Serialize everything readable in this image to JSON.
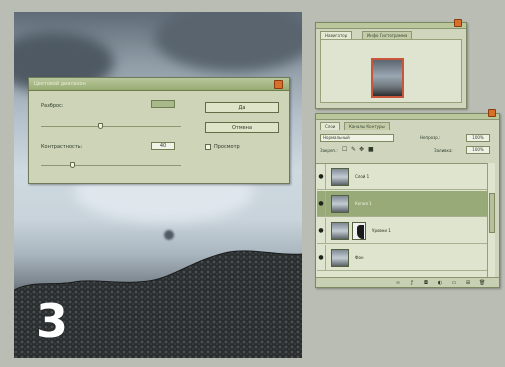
{
  "step_number": "3",
  "dialog": {
    "title": "Цветовой диапазон",
    "fuzziness_label": "Разброс:",
    "fuzziness_value": "",
    "fuzziness_level": 0.42,
    "second_label": "Контрастность:",
    "second_value": "40",
    "second_level": 0.22,
    "ok_label": "Да",
    "cancel_label": "Отмена",
    "preview_label": "Просмотр",
    "preview_checked": false
  },
  "navigator": {
    "tab_1": "Навигатор",
    "tab_2": "Инфо Гистограмма",
    "zoom": ""
  },
  "layers": {
    "tab_1": "Слои",
    "tab_2": "Каналы Контуры",
    "blend_mode": "Нормальный",
    "opacity_label": "Непрозр.:",
    "opacity_value": "100%",
    "lock_label": "Закреп.:",
    "fill_label": "Заливка:",
    "fill_value": "100%",
    "items": [
      {
        "name": "Слой 1",
        "selected": false,
        "has_mask": false
      },
      {
        "name": "Копия 1",
        "selected": true,
        "has_mask": false
      },
      {
        "name": "Уровни 1",
        "selected": false,
        "has_mask": true
      },
      {
        "name": "Фон",
        "selected": false,
        "has_mask": false
      }
    ]
  }
}
